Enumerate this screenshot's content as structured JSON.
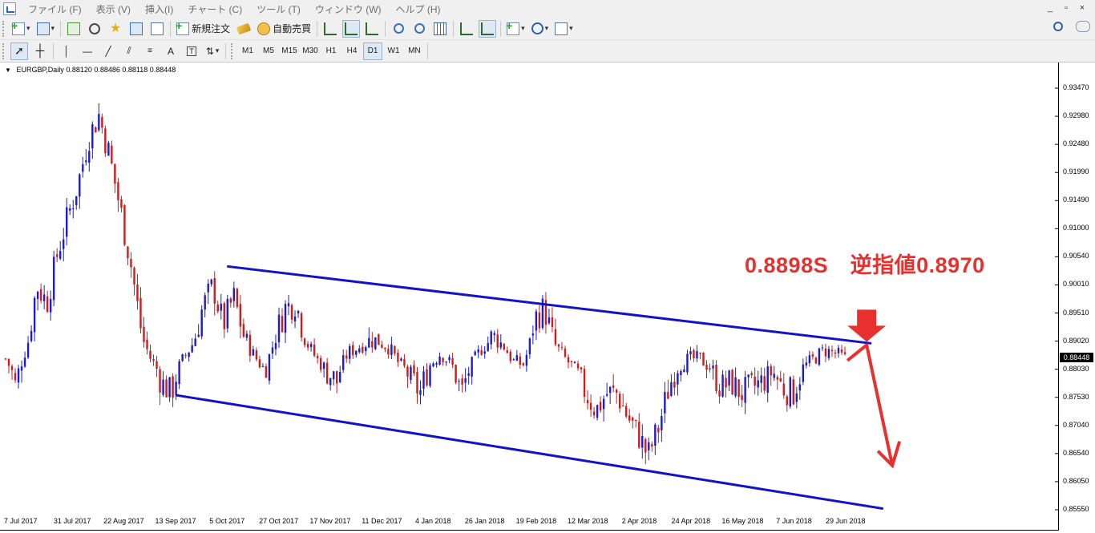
{
  "menu": {
    "items": [
      "ファイル (F)",
      "表示 (V)",
      "挿入(I)",
      "チャート (C)",
      "ツール (T)",
      "ウィンドウ (W)",
      "ヘルプ (H)"
    ],
    "window_controls": [
      "_",
      "▫",
      "×"
    ]
  },
  "toolbar": {
    "new_order_label": "新規注文",
    "auto_trade_label": "自動売買",
    "timeframes": [
      "M1",
      "M5",
      "M15",
      "M30",
      "H1",
      "H4",
      "D1",
      "W1",
      "MN"
    ],
    "active_timeframe": "D1",
    "text_tool": "A"
  },
  "chart_header": {
    "symbol": "EURGBP,Daily",
    "ohlc": "0.88120 0.88486 0.88118 0.88448"
  },
  "chart_data": {
    "type": "candlestick",
    "symbol": "EURGBP",
    "timeframe": "Daily",
    "y_ticks": [
      "0.93470",
      "0.92980",
      "0.92480",
      "0.91990",
      "0.91490",
      "0.91000",
      "0.90540",
      "0.90010",
      "0.89510",
      "0.89020",
      "0.88030",
      "0.87530",
      "0.87040",
      "0.86540",
      "0.86050",
      "0.85550"
    ],
    "x_ticks": [
      "7 Jul 2017",
      "31 Jul 2017",
      "22 Aug 2017",
      "13 Sep 2017",
      "5 Oct 2017",
      "27 Oct 2017",
      "17 Nov 2017",
      "11 Dec 2017",
      "4 Jan 2018",
      "26 Jan 2018",
      "19 Feb 2018",
      "12 Mar 2018",
      "2 Apr 2018",
      "24 Apr 2018",
      "16 May 2018",
      "7 Jun 2018",
      "29 Jun 2018"
    ],
    "current_price": "0.88448",
    "ylim": [
      0.8555,
      0.9347
    ],
    "close_path": [
      0.884,
      0.877,
      0.888,
      0.9,
      0.897,
      0.906,
      0.912,
      0.918,
      0.926,
      0.93,
      0.923,
      0.914,
      0.905,
      0.893,
      0.884,
      0.878,
      0.876,
      0.883,
      0.889,
      0.896,
      0.9,
      0.893,
      0.898,
      0.891,
      0.885,
      0.88,
      0.891,
      0.896,
      0.897,
      0.89,
      0.884,
      0.88,
      0.878,
      0.886,
      0.888,
      0.89,
      0.89,
      0.888,
      0.882,
      0.879,
      0.876,
      0.882,
      0.886,
      0.882,
      0.876,
      0.882,
      0.888,
      0.891,
      0.889,
      0.883,
      0.882,
      0.894,
      0.896,
      0.889,
      0.884,
      0.88,
      0.876,
      0.873,
      0.876,
      0.876,
      0.872,
      0.869,
      0.865,
      0.87,
      0.877,
      0.882,
      0.884,
      0.884,
      0.881,
      0.877,
      0.878,
      0.876,
      0.877,
      0.878,
      0.88,
      0.877,
      0.876,
      0.881,
      0.884,
      0.887,
      0.886,
      0.884
    ],
    "channel_upper": {
      "from": {
        "date": "5 Oct 2017",
        "price": 0.9036
      },
      "to": {
        "date": "10 Jul 2018",
        "price": 0.8894
      }
    },
    "channel_lower": {
      "from": {
        "date": "13 Sep 2017",
        "price": 0.8757
      },
      "to": {
        "date": "15 Jul 2018",
        "price": 0.8557
      }
    },
    "colors": {
      "bull": "#1c1ccc",
      "bear": "#cc1c1c",
      "channel": "#1212c8",
      "annotation": "#e8312f"
    }
  },
  "annotation": {
    "text": "0.8898S　逆指値0.8970"
  }
}
